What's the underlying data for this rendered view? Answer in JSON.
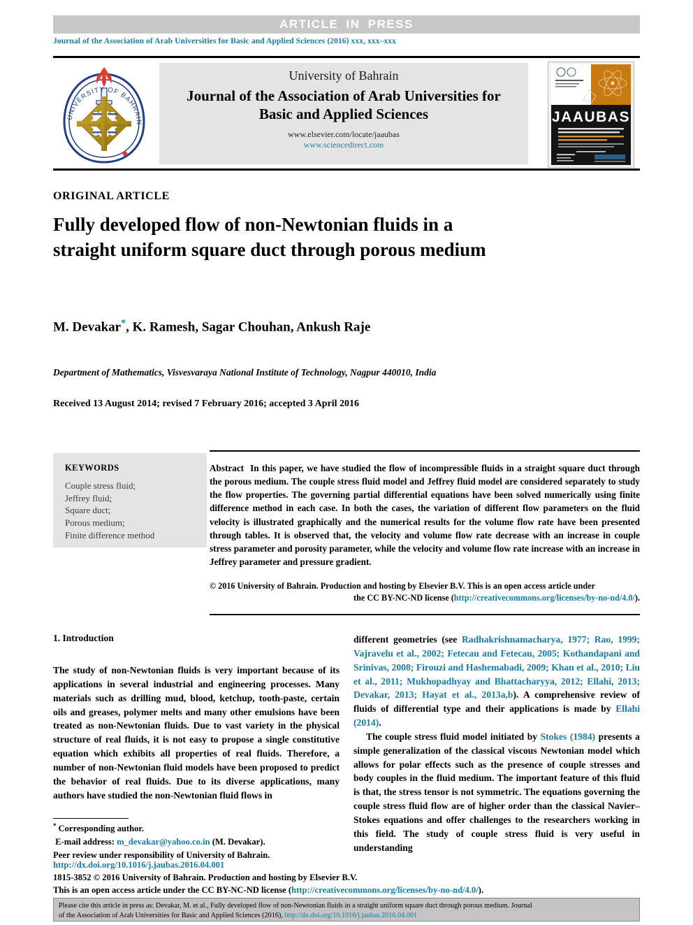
{
  "banner": {
    "press_label": "ARTICLE IN PRESS",
    "journal_ref": "Journal of the Association of Arab Universities for Basic and Applied Sciences (2016) xxx, xxx–xxx"
  },
  "masthead": {
    "university": "University of Bahrain",
    "title_line1": "Journal of the Association of Arab Universities for",
    "title_line2": "Basic and Applied Sciences",
    "url_elsevier": "www.elsevier.com/locate/jaaubas",
    "url_sciencedirect": "www.sciencedirect.com",
    "logo_alt": "university-of-bahrain-seal",
    "cover_title": "JAAUBAS"
  },
  "article": {
    "type_label": "ORIGINAL ARTICLE",
    "title": "Fully developed flow of non-Newtonian fluids in a straight uniform square duct through porous medium",
    "authors": "M. Devakar",
    "authors_rest": ", K. Ramesh, Sagar Chouhan, Ankush Raje",
    "corresponding_marker": "*",
    "affiliation": "Department of Mathematics, Visvesvaraya National Institute of Technology, Nagpur 440010, India",
    "dates": "Received 13 August 2014; revised 7 February 2016; accepted 3 April 2016"
  },
  "keywords": {
    "heading": "KEYWORDS",
    "items": [
      "Couple stress fluid;",
      "Jeffrey fluid;",
      "Square duct;",
      "Porous medium;",
      "Finite difference method"
    ]
  },
  "abstract": {
    "label": "Abstract",
    "text": "In this paper, we have studied the flow of incompressible fluids in a straight square duct through the porous medium. The couple stress fluid model and Jeffrey fluid model are considered separately to study the flow properties. The governing partial differential equations have been solved numerically using finite difference method in each case. In both the cases, the variation of different flow parameters on the fluid velocity is illustrated graphically and the numerical results for the volume flow rate have been presented through tables. It is observed that, the velocity and volume flow rate decrease with an increase in couple stress parameter and porosity parameter, while the velocity and volume flow rate increase with an increase in Jeffrey parameter and pressure gradient.",
    "copyright_line1": "© 2016 University of Bahrain. Production and hosting by Elsevier B.V. This is an open access article under",
    "copyright_line2_pre": "the CC BY-NC-ND license (",
    "copyright_license_url": "http://creativecommons.org/licenses/by-no-nd/4.0/",
    "copyright_line2_post": ")."
  },
  "introduction": {
    "heading": "1. Introduction",
    "left_paragraph": "The study of non-Newtonian fluids is very important because of its applications in several industrial and engineering processes. Many materials such as drilling mud, blood, ketchup, tooth-paste, certain oils and greases, polymer melts and many other emulsions have been treated as non-Newtonian fluids. Due to vast variety in the physical structure of real fluids, it is not easy to propose a single constitutive equation which exhibits all properties of real fluids. Therefore, a number of non-Newtonian fluid models have been proposed to predict the behavior of real fluids. Due to its diverse applications, many authors have studied the non-Newtonian fluid flows in",
    "right_p1_pre": "different geometries (see ",
    "right_p1_cites": "Radhakrishnamacharya, 1977; Rao, 1999; Vajravelu et al., 2002; Fetecau and Fetecau, 2005; Kothandapani and Srinivas, 2008; Firouzi and Hashemabadi, 2009; Khan et al., 2010; Liu et al., 2011; Mukhopadhyay and Bhattacharyya, 2012; Ellahi, 2013; Devakar, 2013; Hayat et al., 2013a,b",
    "right_p1_mid": "). A comprehensive review of fluids of differential type and their applications is made by ",
    "right_p1_cite2": "Ellahi (2014)",
    "right_p1_end": ".",
    "right_p2_pre": "The couple stress fluid model initiated by ",
    "right_p2_cite": "Stokes (1984)",
    "right_p2_post": " presents a simple generalization of the classical viscous Newtonian model which allows for polar effects such as the presence of couple stresses and body couples in the fluid medium. The important feature of this fluid is that, the stress tensor is not symmetric. The equations governing the couple stress fluid flow are of higher order than the classical Navier–Stokes equations and offer challenges to the researchers working in this field. The study of couple stress fluid is very useful in understanding"
  },
  "footnotes": {
    "corresponding": "Corresponding author.",
    "email_label": "E-mail address:",
    "email": "m_devakar@yahoo.co.in",
    "email_suffix": "(M. Devakar).",
    "peer_review": "Peer review under responsibility of University of Bahrain."
  },
  "publisher": {
    "doi": "http://dx.doi.org/10.1016/j.jaubas.2016.04.001",
    "issn_line": "1815-3852 © 2016 University of Bahrain. Production and hosting by Elsevier B.V.",
    "license_pre": "This is an open access article under the CC BY-NC-ND license (",
    "license_url": "http://creativecommons.org/licenses/by-no-nd/4.0/",
    "license_post": ")."
  },
  "cite_box": {
    "line1": "Please cite this article in press as: Devakar, M. et al., Fully developed flow of non-Newtonian fluids in a straight uniform square duct through porous medium. Journal",
    "line2_pre": "of the Association of Arab Universities for Basic and Applied Sciences (2016), ",
    "line2_url": "http://dx.doi.org/10.1016/j.jaubas.2016.04.001"
  },
  "colors": {
    "link_blue": "#1a7ba8",
    "banner_gray": "#c8c8c8",
    "box_gray": "#e4e4e4"
  }
}
